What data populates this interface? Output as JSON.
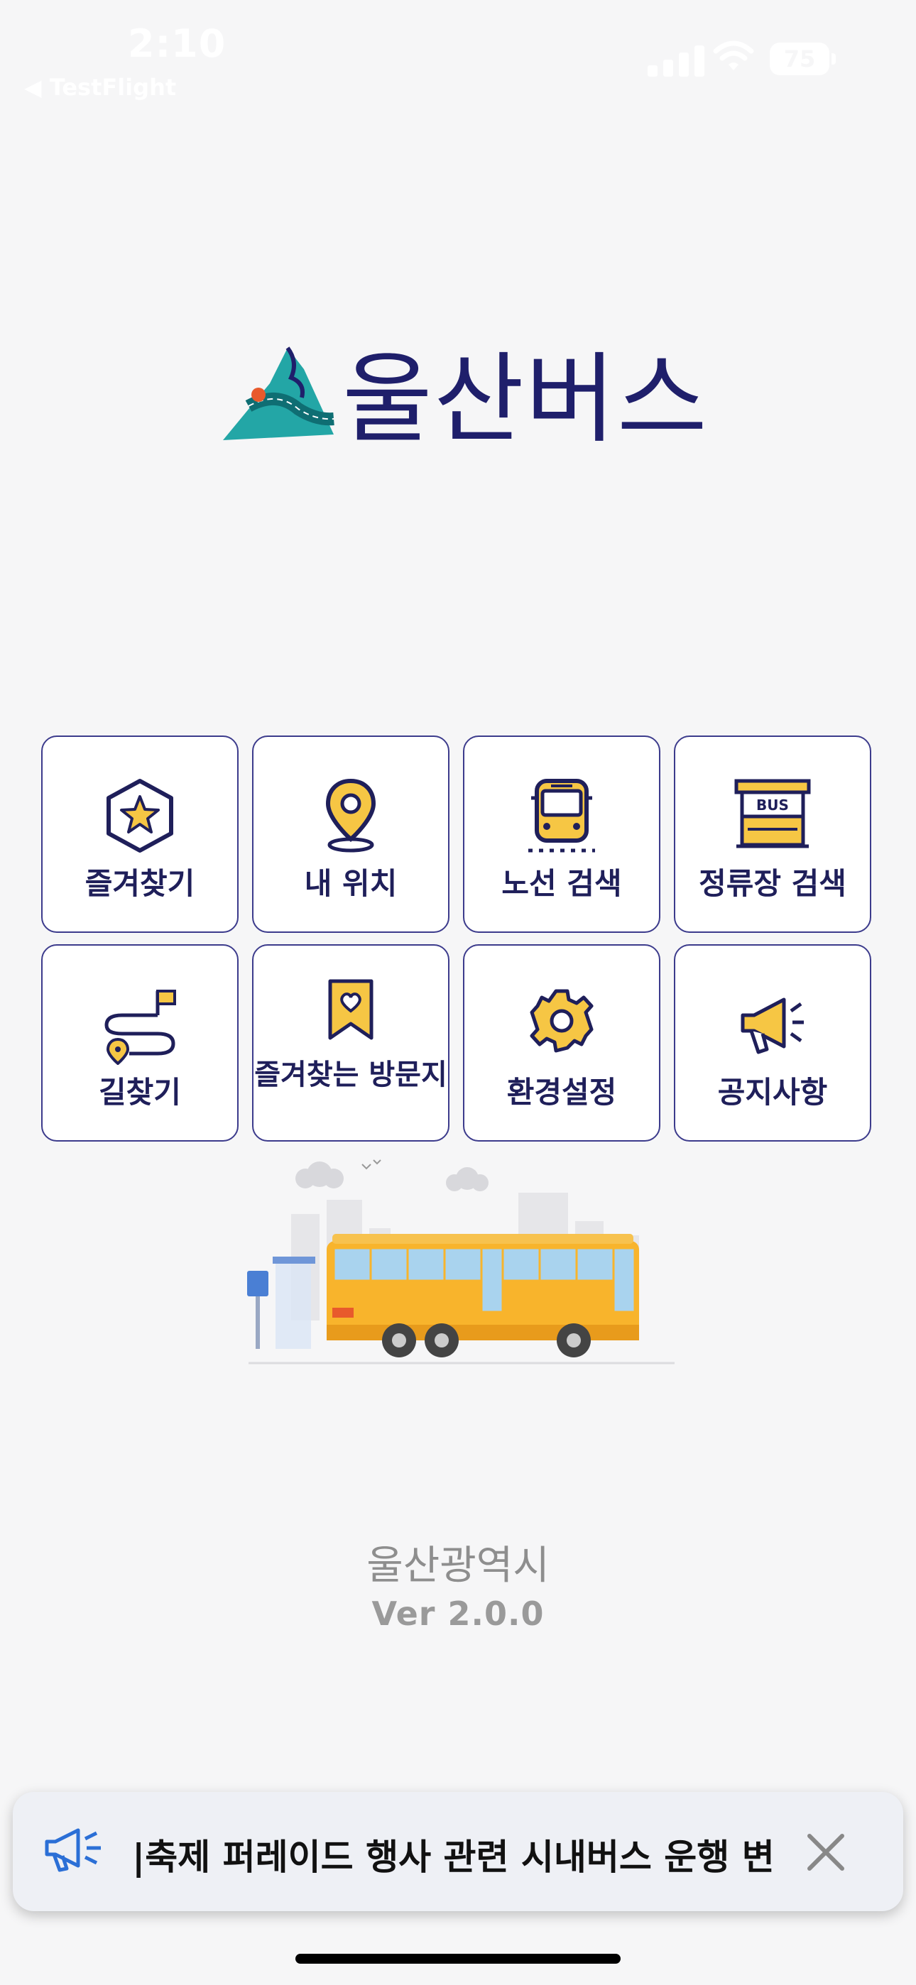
{
  "status_bar": {
    "time": "2:10",
    "back_label": "◀ TestFlight",
    "battery": "75"
  },
  "logo": {
    "text": "울산버스"
  },
  "menu": [
    {
      "label": "즐겨찾기",
      "icon": "star-badge-icon"
    },
    {
      "label": "내 위치",
      "icon": "location-pin-icon"
    },
    {
      "label": "노선 검색",
      "icon": "bus-front-icon"
    },
    {
      "label": "정류장 검색",
      "icon": "bus-stop-icon"
    },
    {
      "label": "길찾기",
      "icon": "route-icon"
    },
    {
      "label": "즐겨찾는 방문지",
      "icon": "heart-bookmark-icon"
    },
    {
      "label": "환경설정",
      "icon": "gear-icon"
    },
    {
      "label": "공지사항",
      "icon": "megaphone-icon"
    }
  ],
  "footer": {
    "org": "울산광역시",
    "version": "Ver 2.0.0"
  },
  "notice": {
    "text": "|축제 퍼레이드 행사 관련 시내버스 운행 변"
  },
  "colors": {
    "accent": "#1f1f6b",
    "icon_yellow": "#f6c644",
    "border": "#3c3b8c",
    "notice_blue": "#2b6fd6"
  }
}
